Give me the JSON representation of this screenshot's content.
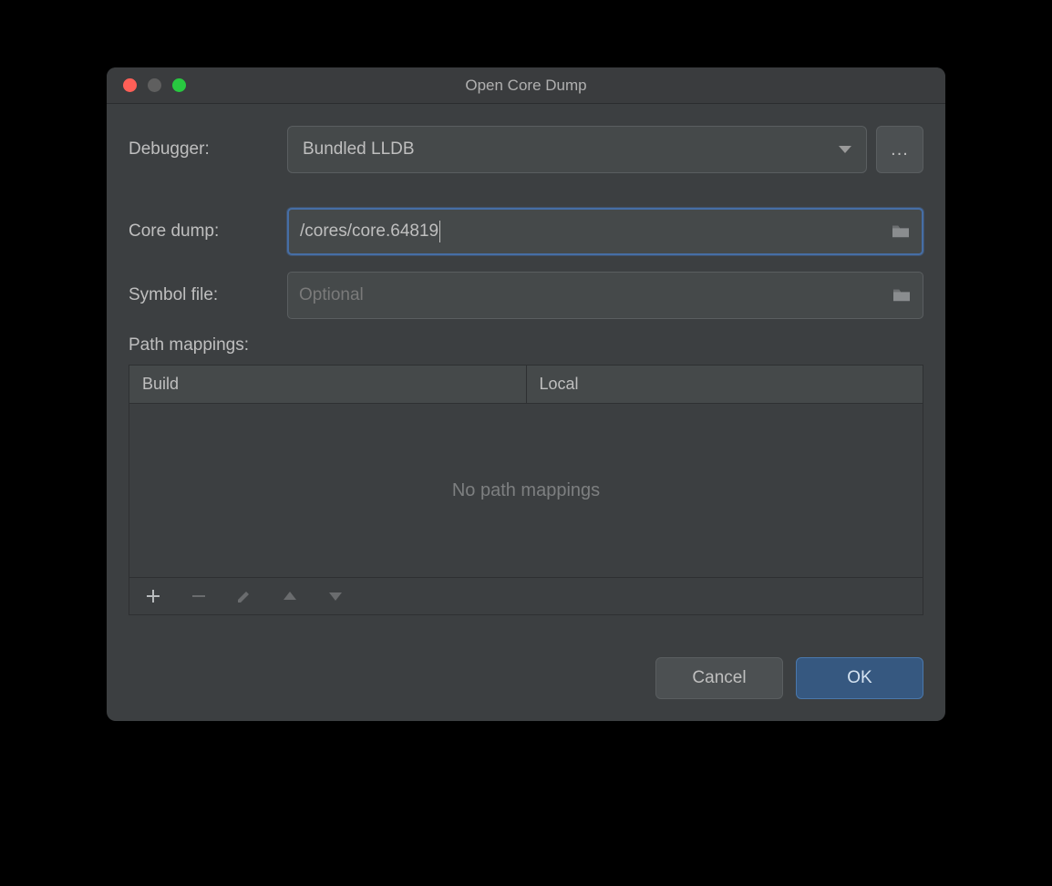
{
  "title": "Open Core Dump",
  "debugger": {
    "label": "Debugger:",
    "value": "Bundled LLDB",
    "moreLabel": "..."
  },
  "coreDump": {
    "label": "Core dump:",
    "value": "/cores/core.64819"
  },
  "symbolFile": {
    "label": "Symbol file:",
    "placeholder": "Optional",
    "value": ""
  },
  "pathMappings": {
    "label": "Path mappings:",
    "columns": {
      "build": "Build",
      "local": "Local"
    },
    "empty": "No path mappings"
  },
  "buttons": {
    "cancel": "Cancel",
    "ok": "OK"
  }
}
